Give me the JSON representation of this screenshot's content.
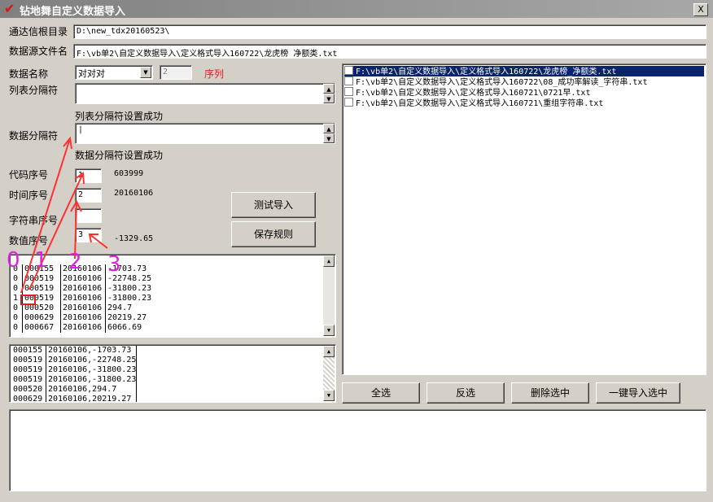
{
  "window": {
    "title": "钻地舞自定义数据导入",
    "close_label": "X"
  },
  "form": {
    "tdx_dir_label": "通达信根目录",
    "tdx_dir_value": "D:\\new_tdx20160523\\",
    "source_file_label": "数据源文件名",
    "source_file_value": "F:\\vb单2\\自定义数据导入\\定义格式导入160722\\龙虎榜_净额类.txt",
    "data_name_label": "数据名称",
    "data_name_value": "对对对",
    "seq_value": "2",
    "seq_label": "序列",
    "list_sep_label": "列表分隔符",
    "list_sep_value": "",
    "list_sep_status": "列表分隔符设置成功",
    "data_sep_label": "数据分隔符",
    "data_sep_value": "|",
    "data_sep_status": "数据分隔符设置成功",
    "code_idx_label": "代码序号",
    "code_idx_value": "1",
    "code_sample": "603999",
    "time_idx_label": "时间序号",
    "time_idx_value": "2",
    "time_sample": "20160106",
    "str_idx_label": "字符串序号",
    "str_idx_value": "",
    "num_idx_label": "数值序号",
    "num_idx_value": "3",
    "num_sample": "-1329.65"
  },
  "buttons": {
    "test_import": "测试导入",
    "save_rule": "保存规则",
    "select_all": "全选",
    "invert_select": "反选",
    "delete_selected": "删除选中",
    "import_selected": "一键导入选中"
  },
  "annotations": [
    "0",
    "1",
    "2",
    "3"
  ],
  "preview_table": [
    [
      "0",
      "000155",
      "20160106",
      "-1703.73"
    ],
    [
      "0",
      "000519",
      "20160106",
      "-22748.25"
    ],
    [
      "0",
      "000519",
      "20160106",
      "-31800.23"
    ],
    [
      "1",
      "000519",
      "20160106",
      "-31800.23"
    ],
    [
      "0",
      "000520",
      "20160106",
      "294.7"
    ],
    [
      "0",
      "000629",
      "20160106",
      "20219.27"
    ],
    [
      "0",
      "000667",
      "20160106",
      "6066.69"
    ]
  ],
  "parsed_rows": [
    [
      "000155",
      "20160106,-1703.73"
    ],
    [
      "000519",
      "20160106,-22748.25"
    ],
    [
      "000519",
      "20160106,-31800.23"
    ],
    [
      "000519",
      "20160106,-31800.23"
    ],
    [
      "000520",
      "20160106,294.7"
    ],
    [
      "000629",
      "20160106,20219.27"
    ]
  ],
  "file_list": [
    {
      "path": "F:\\vb单2\\自定义数据导入\\定义格式导入160722\\龙虎榜_净额类.txt",
      "selected": true
    },
    {
      "path": "F:\\vb单2\\自定义数据导入\\定义格式导入160722\\08_成功率解读_字符串.txt",
      "selected": false
    },
    {
      "path": "F:\\vb单2\\自定义数据导入\\定义格式导入160721\\0721早.txt",
      "selected": false
    },
    {
      "path": "F:\\vb单2\\自定义数据导入\\定义格式导入160721\\重组字符串.txt",
      "selected": false
    }
  ],
  "colors": {
    "accent_red": "#e02020",
    "annotation_magenta": "#e020e0",
    "selection_blue": "#0a246a"
  }
}
